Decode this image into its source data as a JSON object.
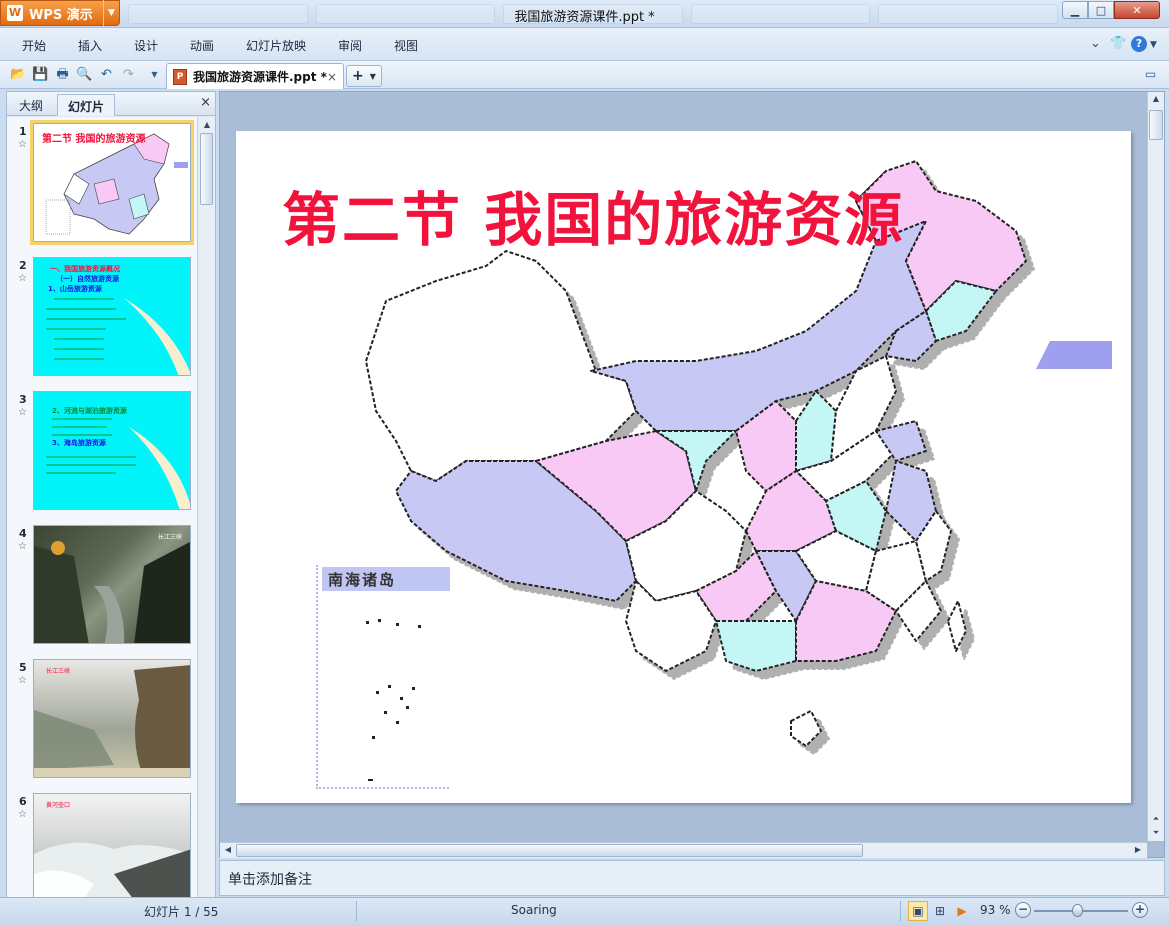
{
  "app": {
    "name": "WPS 演示",
    "window_title": "我国旅游资源课件.ppt *"
  },
  "menu": {
    "items": [
      "开始",
      "插入",
      "设计",
      "动画",
      "幻灯片放映",
      "审阅",
      "视图"
    ]
  },
  "toolbar": {
    "icons": [
      "open-folder-icon",
      "save-icon",
      "print-icon",
      "print-preview-icon",
      "undo-icon",
      "redo-icon",
      "customize-dropdown-icon"
    ]
  },
  "document_tab": {
    "label": "我国旅游资源课件.ppt *",
    "close": "×",
    "new_tab": "+"
  },
  "left_panel": {
    "tabs": [
      "大纲",
      "幻灯片"
    ],
    "active_tab": "幻灯片",
    "close": "×",
    "thumbnails": [
      {
        "num": "1",
        "title": "第二节  我国的旅游资源"
      },
      {
        "num": "2",
        "line1": "一、我国旅游资源概况",
        "line2": "（一）自然旅游资源",
        "line3": "1、山岳旅游资源"
      },
      {
        "num": "3",
        "line1": "2、河流与湖泊旅游资源",
        "line2": "3、海岛旅游资源"
      },
      {
        "num": "4",
        "caption": "长江三峡"
      },
      {
        "num": "5",
        "caption": "长江三峡"
      },
      {
        "num": "6",
        "caption": "黄河壶口"
      }
    ]
  },
  "slide": {
    "title": "第二节  我国的旅游资源",
    "inset_label": "南海诸岛"
  },
  "notes": {
    "placeholder": "单击添加备注"
  },
  "status": {
    "slide_counter": "幻灯片 1 / 55",
    "theme": "Soaring",
    "zoom": "93 %",
    "zoom_minus": "−",
    "zoom_plus": "+"
  },
  "colors": {
    "accent_orange": "#e26a10",
    "slide_title_red": "#f2133d",
    "map_lavender": "#c7c8f4",
    "map_pink": "#f8c9f5",
    "map_cyan": "#c3f6f5"
  }
}
